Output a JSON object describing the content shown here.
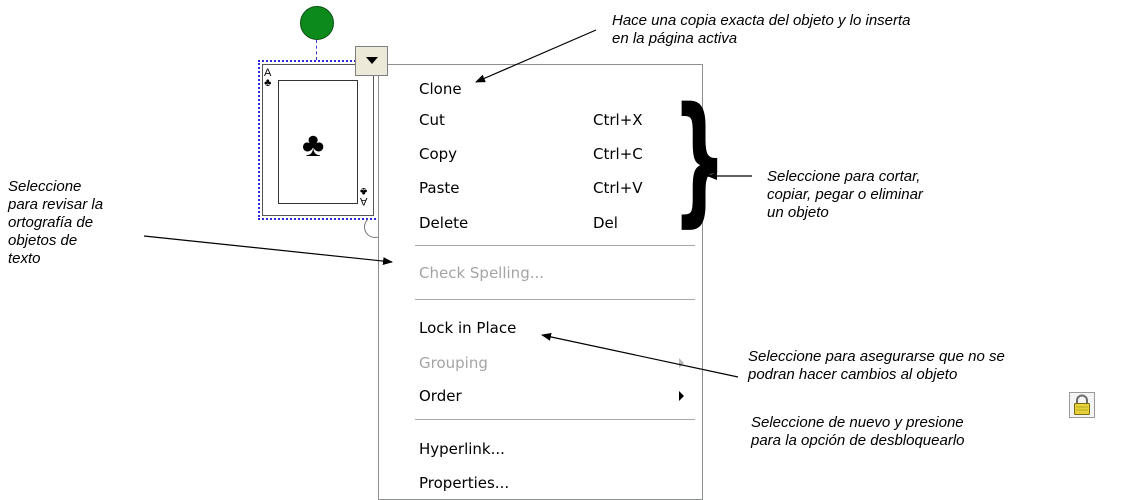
{
  "card": {
    "rank": "A",
    "suit_symbol": "♣"
  },
  "menu": {
    "items": [
      {
        "label": "Clone",
        "shortcut": ""
      },
      {
        "label": "Cut",
        "shortcut": "Ctrl+X"
      },
      {
        "label": "Copy",
        "shortcut": "Ctrl+C"
      },
      {
        "label": "Paste",
        "shortcut": "Ctrl+V"
      },
      {
        "label": "Delete",
        "shortcut": "Del"
      },
      {
        "label": "Check Spelling...",
        "shortcut": "",
        "disabled": true
      },
      {
        "label": "Lock in Place",
        "shortcut": ""
      },
      {
        "label": "Grouping",
        "shortcut": "",
        "disabled": true,
        "submenu": true
      },
      {
        "label": "Order",
        "shortcut": "",
        "submenu": true
      },
      {
        "label": "Hyperlink...",
        "shortcut": ""
      },
      {
        "label": "Properties...",
        "shortcut": ""
      }
    ]
  },
  "annotations": {
    "clone_line1": "Hace una copia exacta del objeto y lo inserta",
    "clone_line2": "en la página activa",
    "edit_line1": "Seleccione para cortar,",
    "edit_line2": "copiar, pegar o eliminar",
    "edit_line3": "un objeto",
    "spell_line1": "Seleccione",
    "spell_line2": "para revisar la",
    "spell_line3": "ortografía de",
    "spell_line4": "objetos de",
    "spell_line5": "texto",
    "lock_line1": "Seleccione para asegurarse que no se",
    "lock_line2": "podran hacer cambios al objeto",
    "unlock_line1": "Seleccione de nuevo y presione",
    "unlock_line2": "para la opción de desbloquearlo"
  },
  "icons": {
    "lock": "lock-icon",
    "menu_dropdown": "chevron-down-icon",
    "rotate_handle": "rotate-handle-icon"
  }
}
